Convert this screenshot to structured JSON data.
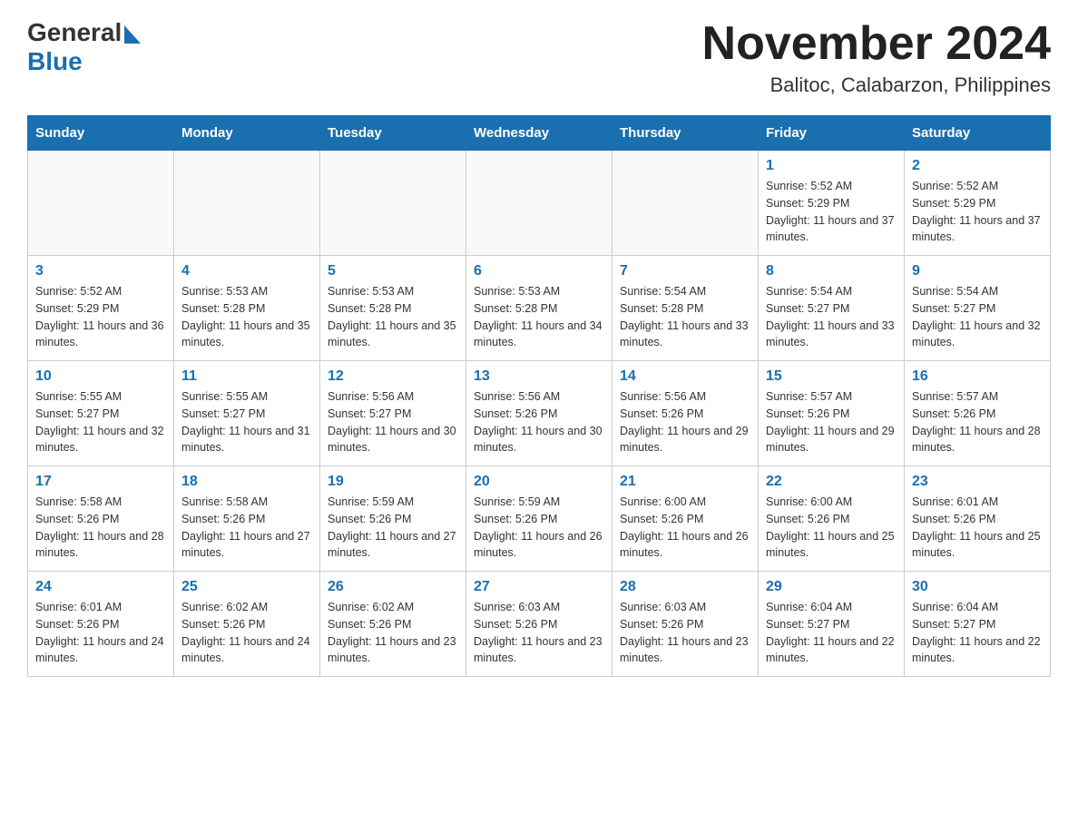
{
  "header": {
    "logo_general": "General",
    "logo_blue": "Blue",
    "title": "November 2024",
    "subtitle": "Balitoc, Calabarzon, Philippines"
  },
  "calendar": {
    "days_of_week": [
      "Sunday",
      "Monday",
      "Tuesday",
      "Wednesday",
      "Thursday",
      "Friday",
      "Saturday"
    ],
    "weeks": [
      [
        {
          "day": "",
          "info": ""
        },
        {
          "day": "",
          "info": ""
        },
        {
          "day": "",
          "info": ""
        },
        {
          "day": "",
          "info": ""
        },
        {
          "day": "",
          "info": ""
        },
        {
          "day": "1",
          "info": "Sunrise: 5:52 AM\nSunset: 5:29 PM\nDaylight: 11 hours and 37 minutes."
        },
        {
          "day": "2",
          "info": "Sunrise: 5:52 AM\nSunset: 5:29 PM\nDaylight: 11 hours and 37 minutes."
        }
      ],
      [
        {
          "day": "3",
          "info": "Sunrise: 5:52 AM\nSunset: 5:29 PM\nDaylight: 11 hours and 36 minutes."
        },
        {
          "day": "4",
          "info": "Sunrise: 5:53 AM\nSunset: 5:28 PM\nDaylight: 11 hours and 35 minutes."
        },
        {
          "day": "5",
          "info": "Sunrise: 5:53 AM\nSunset: 5:28 PM\nDaylight: 11 hours and 35 minutes."
        },
        {
          "day": "6",
          "info": "Sunrise: 5:53 AM\nSunset: 5:28 PM\nDaylight: 11 hours and 34 minutes."
        },
        {
          "day": "7",
          "info": "Sunrise: 5:54 AM\nSunset: 5:28 PM\nDaylight: 11 hours and 33 minutes."
        },
        {
          "day": "8",
          "info": "Sunrise: 5:54 AM\nSunset: 5:27 PM\nDaylight: 11 hours and 33 minutes."
        },
        {
          "day": "9",
          "info": "Sunrise: 5:54 AM\nSunset: 5:27 PM\nDaylight: 11 hours and 32 minutes."
        }
      ],
      [
        {
          "day": "10",
          "info": "Sunrise: 5:55 AM\nSunset: 5:27 PM\nDaylight: 11 hours and 32 minutes."
        },
        {
          "day": "11",
          "info": "Sunrise: 5:55 AM\nSunset: 5:27 PM\nDaylight: 11 hours and 31 minutes."
        },
        {
          "day": "12",
          "info": "Sunrise: 5:56 AM\nSunset: 5:27 PM\nDaylight: 11 hours and 30 minutes."
        },
        {
          "day": "13",
          "info": "Sunrise: 5:56 AM\nSunset: 5:26 PM\nDaylight: 11 hours and 30 minutes."
        },
        {
          "day": "14",
          "info": "Sunrise: 5:56 AM\nSunset: 5:26 PM\nDaylight: 11 hours and 29 minutes."
        },
        {
          "day": "15",
          "info": "Sunrise: 5:57 AM\nSunset: 5:26 PM\nDaylight: 11 hours and 29 minutes."
        },
        {
          "day": "16",
          "info": "Sunrise: 5:57 AM\nSunset: 5:26 PM\nDaylight: 11 hours and 28 minutes."
        }
      ],
      [
        {
          "day": "17",
          "info": "Sunrise: 5:58 AM\nSunset: 5:26 PM\nDaylight: 11 hours and 28 minutes."
        },
        {
          "day": "18",
          "info": "Sunrise: 5:58 AM\nSunset: 5:26 PM\nDaylight: 11 hours and 27 minutes."
        },
        {
          "day": "19",
          "info": "Sunrise: 5:59 AM\nSunset: 5:26 PM\nDaylight: 11 hours and 27 minutes."
        },
        {
          "day": "20",
          "info": "Sunrise: 5:59 AM\nSunset: 5:26 PM\nDaylight: 11 hours and 26 minutes."
        },
        {
          "day": "21",
          "info": "Sunrise: 6:00 AM\nSunset: 5:26 PM\nDaylight: 11 hours and 26 minutes."
        },
        {
          "day": "22",
          "info": "Sunrise: 6:00 AM\nSunset: 5:26 PM\nDaylight: 11 hours and 25 minutes."
        },
        {
          "day": "23",
          "info": "Sunrise: 6:01 AM\nSunset: 5:26 PM\nDaylight: 11 hours and 25 minutes."
        }
      ],
      [
        {
          "day": "24",
          "info": "Sunrise: 6:01 AM\nSunset: 5:26 PM\nDaylight: 11 hours and 24 minutes."
        },
        {
          "day": "25",
          "info": "Sunrise: 6:02 AM\nSunset: 5:26 PM\nDaylight: 11 hours and 24 minutes."
        },
        {
          "day": "26",
          "info": "Sunrise: 6:02 AM\nSunset: 5:26 PM\nDaylight: 11 hours and 23 minutes."
        },
        {
          "day": "27",
          "info": "Sunrise: 6:03 AM\nSunset: 5:26 PM\nDaylight: 11 hours and 23 minutes."
        },
        {
          "day": "28",
          "info": "Sunrise: 6:03 AM\nSunset: 5:26 PM\nDaylight: 11 hours and 23 minutes."
        },
        {
          "day": "29",
          "info": "Sunrise: 6:04 AM\nSunset: 5:27 PM\nDaylight: 11 hours and 22 minutes."
        },
        {
          "day": "30",
          "info": "Sunrise: 6:04 AM\nSunset: 5:27 PM\nDaylight: 11 hours and 22 minutes."
        }
      ]
    ]
  }
}
